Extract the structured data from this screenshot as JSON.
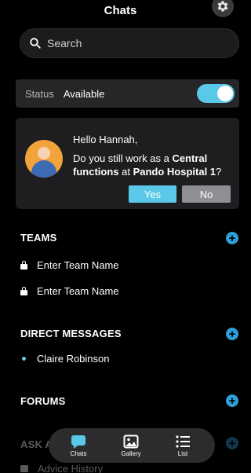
{
  "header": {
    "title": "Chats",
    "settings_icon": "gear-icon"
  },
  "search": {
    "placeholder": "Search"
  },
  "status": {
    "label": "Status",
    "value": "Available",
    "toggle_on": true,
    "toggle_color": "#5ac8e8"
  },
  "prompt": {
    "greeting": "Hello Hannah,",
    "question_prefix": "Do you still work as a ",
    "role": "Central functions",
    "question_middle": " at ",
    "organization": "Pando Hospital 1",
    "question_suffix": "?",
    "yes_label": "Yes",
    "no_label": "No"
  },
  "sections": {
    "teams": {
      "title": "TEAMS",
      "items": [
        "Enter Team Name",
        "Enter Team Name"
      ]
    },
    "direct_messages": {
      "title": "DIRECT MESSAGES",
      "items": [
        "Claire Robinson"
      ]
    },
    "forums": {
      "title": "FORUMS"
    },
    "ask": {
      "title": "ASK A",
      "items": [
        "Advice History"
      ]
    }
  },
  "tabbar": {
    "tabs": [
      {
        "label": "Chats",
        "icon": "chat-bubble-icon",
        "active": true
      },
      {
        "label": "Gallery",
        "icon": "image-icon",
        "active": false
      },
      {
        "label": "List",
        "icon": "list-icon",
        "active": false
      }
    ]
  },
  "colors": {
    "accent": "#5ac8e8",
    "add_button": "#2f9fd8",
    "background": "#000000"
  }
}
